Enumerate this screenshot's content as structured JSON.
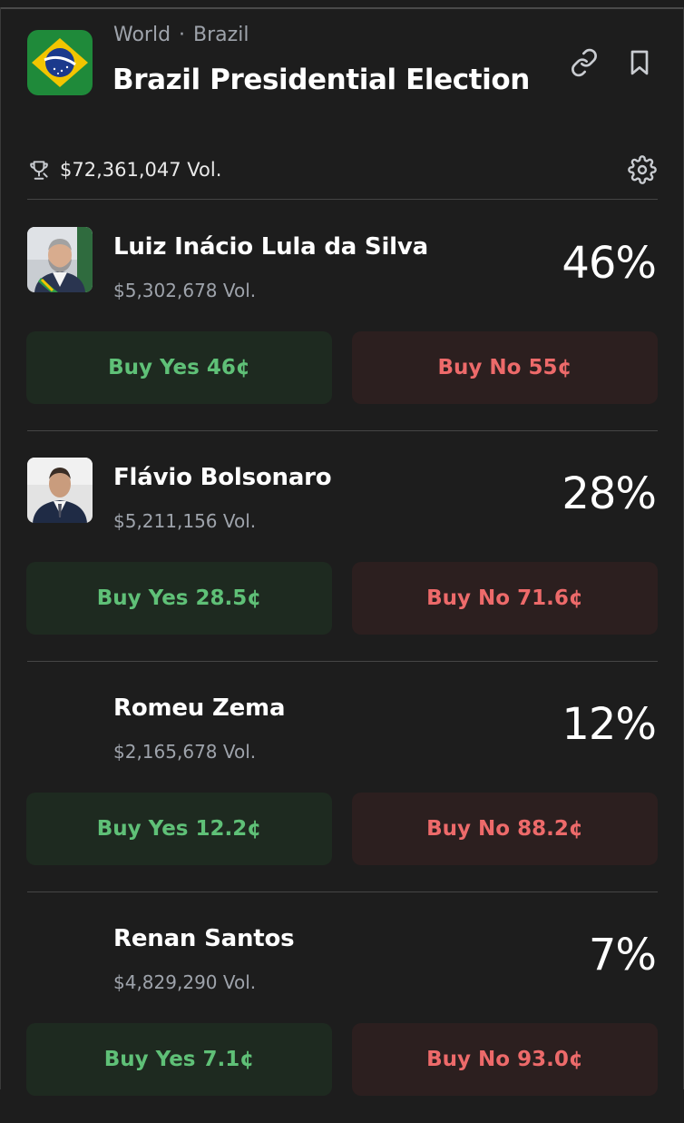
{
  "header": {
    "breadcrumb": [
      "World",
      "Brazil"
    ],
    "breadcrumb_separator": "·",
    "title": "Brazil Presidential Election",
    "flag_icon": "brazil-flag-icon",
    "actions": [
      "link-icon",
      "bookmark-icon"
    ]
  },
  "market": {
    "volume": "$72,361,047 Vol.",
    "volume_icon": "trophy-icon",
    "settings_icon": "gear-icon"
  },
  "colors": {
    "background": "#1d1d1d",
    "yes_text": "#5fc077",
    "yes_bg": "#1e2a20",
    "no_text": "#ed6a6a",
    "no_bg": "#2c1f1f",
    "muted_text": "#9ea3ab"
  },
  "candidates": [
    {
      "name": "Luiz Inácio Lula da Silva",
      "volume": "$5,302,678 Vol.",
      "percent": "46%",
      "buy_yes": "Buy Yes 46¢",
      "buy_no": "Buy No 55¢",
      "has_photo": true
    },
    {
      "name": "Flávio Bolsonaro",
      "volume": "$5,211,156 Vol.",
      "percent": "28%",
      "buy_yes": "Buy Yes 28.5¢",
      "buy_no": "Buy No 71.6¢",
      "has_photo": true
    },
    {
      "name": "Romeu Zema",
      "volume": "$2,165,678 Vol.",
      "percent": "12%",
      "buy_yes": "Buy Yes 12.2¢",
      "buy_no": "Buy No 88.2¢",
      "has_photo": false
    },
    {
      "name": "Renan Santos",
      "volume": "$4,829,290 Vol.",
      "percent": "7%",
      "buy_yes": "Buy Yes 7.1¢",
      "buy_no": "Buy No 93.0¢",
      "has_photo": false
    }
  ]
}
